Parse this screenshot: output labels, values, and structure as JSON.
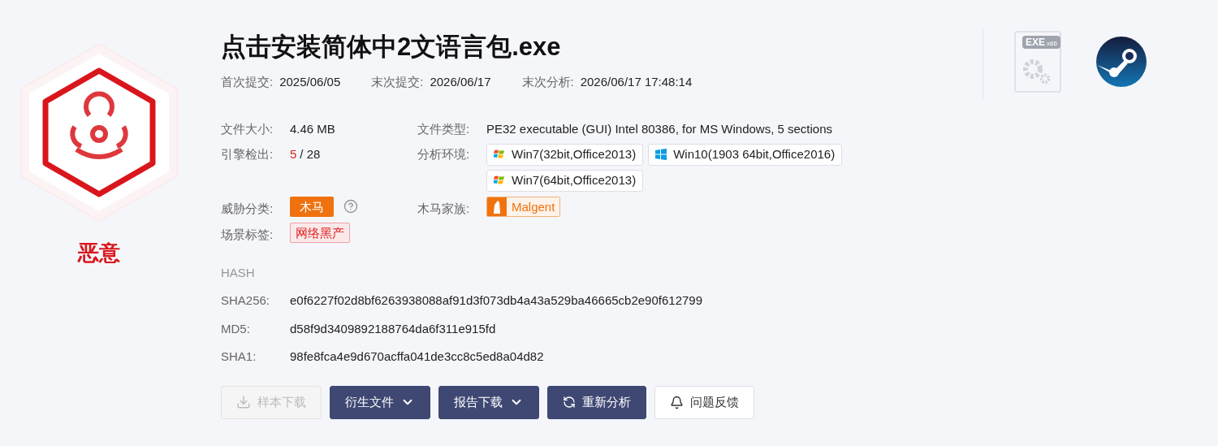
{
  "verdict": {
    "kind": "malicious",
    "label": "恶意"
  },
  "file_name": "点击安装简体中2文语言包.exe",
  "dates": [
    {
      "label": "首次提交:",
      "value": "2025/06/05"
    },
    {
      "label": "末次提交:",
      "value": "2026/06/17"
    },
    {
      "label": "末次分析:",
      "value": "2026/06/17 17:48:14"
    }
  ],
  "size": {
    "label": "文件大小:",
    "value": "4.46 MB"
  },
  "file_type": {
    "label": "文件类型:",
    "value": "PE32 executable (GUI) Intel 80386, for MS Windows, 5 sections"
  },
  "detections": {
    "label": "引擎检出:",
    "hits": "5",
    "total": "/ 28"
  },
  "environments": {
    "label": "分析环境:",
    "items": [
      {
        "kind": "win7",
        "text": "Win7(32bit,Office2013)"
      },
      {
        "kind": "win10",
        "text": "Win10(1903 64bit,Office2016)"
      },
      {
        "kind": "win7",
        "text": "Win7(64bit,Office2013)"
      }
    ]
  },
  "threat": {
    "label": "威胁分类:",
    "tag": "木马"
  },
  "family": {
    "label": "木马家族:",
    "tag": "Malgent"
  },
  "scene": {
    "label": "场景标签:",
    "tags": [
      "网络黑产"
    ]
  },
  "file_icon": {
    "label": "EXE",
    "sub": "x86"
  },
  "hash": {
    "title": "HASH",
    "rows": [
      {
        "label": "SHA256:",
        "value": "e0f6227f02d8bf6263938088af91d3f073db4a43a529ba46665cb2e90f612799"
      },
      {
        "label": "MD5:",
        "value": "d58f9d3409892188764da6f311e915fd"
      },
      {
        "label": "SHA1:",
        "value": "98fe8fca4e9d670acffa041de3cc8c5ed8a04d82"
      }
    ]
  },
  "actions": [
    {
      "label": "样本下载",
      "kind": "download",
      "disabled": true
    },
    {
      "label": "衍生文件",
      "kind": "menu",
      "disabled": false
    },
    {
      "label": "报告下载",
      "kind": "menu",
      "disabled": false
    },
    {
      "label": "重新分析",
      "kind": "reanalyze",
      "disabled": false
    },
    {
      "label": "问题反馈",
      "kind": "feedback",
      "disabled": false
    }
  ]
}
